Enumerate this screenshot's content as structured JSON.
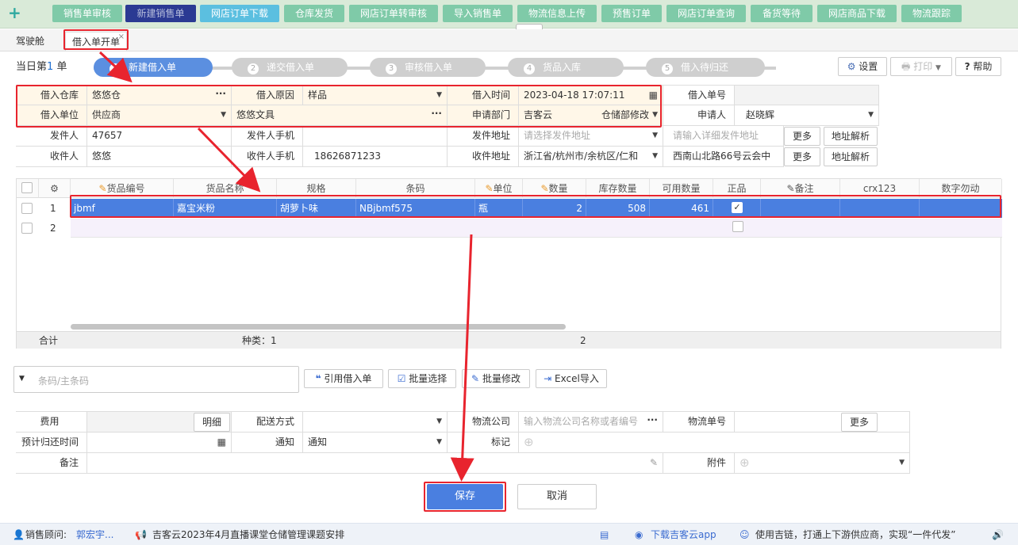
{
  "nav": {
    "plus": "+",
    "tabs": [
      "销售单审核",
      "新建销售单",
      "网店订单下载",
      "仓库发货",
      "网店订单转审核",
      "导入销售单",
      "物流信息上传",
      "预售订单",
      "网店订单查询",
      "备货等待",
      "网店商品下载",
      "物流跟踪"
    ]
  },
  "subtabs": {
    "cockpit": "驾驶舱",
    "current": "借入单开单",
    "close": "×"
  },
  "steps": {
    "day_prefix": "当日第",
    "day_num": "1",
    "day_suffix": "单",
    "items": [
      {
        "n": "1",
        "label": "新建借入单"
      },
      {
        "n": "2",
        "label": "递交借入单"
      },
      {
        "n": "3",
        "label": "审核借入单"
      },
      {
        "n": "4",
        "label": "货品入库"
      },
      {
        "n": "5",
        "label": "借入待归还"
      }
    ]
  },
  "toolbar": {
    "settings": "设置",
    "print": "打印",
    "help": "帮助"
  },
  "form": {
    "warehouse_label": "借入仓库",
    "warehouse": "悠悠仓",
    "reason_label": "借入原因",
    "reason": "样品",
    "time_label": "借入时间",
    "time": "2023-04-18 17:07:11",
    "order_no_label": "借入单号",
    "order_no": "",
    "unit_label": "借入单位",
    "unit_type": "供应商",
    "unit": "悠悠文具",
    "dept_label": "申请部门",
    "dept": "吉客云",
    "dept2": "仓储部修改",
    "applicant_label": "申请人",
    "applicant": "赵晓辉",
    "sender_label": "发件人",
    "sender": "47657",
    "sender_phone_label": "发件人手机",
    "sender_phone": "",
    "sender_addr_label": "发件地址",
    "sender_addr_ph": "请选择发件地址",
    "sender_detail_ph": "请输入详细发件地址",
    "more": "更多",
    "parse": "地址解析",
    "receiver_label": "收件人",
    "receiver": "悠悠",
    "receiver_phone_label": "收件人手机",
    "receiver_phone": "18626871233",
    "receiver_addr_label": "收件地址",
    "receiver_addr": "浙江省/杭州市/余杭区/仁和",
    "receiver_detail": "西南山北路66号云会中"
  },
  "table": {
    "headers": [
      "货品编号",
      "货品名称",
      "规格",
      "条码",
      "单位",
      "数量",
      "库存数量",
      "可用数量",
      "正品",
      "备注",
      "crx123",
      "数字勿动"
    ],
    "rows": [
      {
        "no": "1",
        "code": "jbmf",
        "name": "嘉宝米粉",
        "spec": "胡萝卜味",
        "barcode": "NBjbmf575",
        "unit": "瓶",
        "qty": "2",
        "stock": "508",
        "avail": "461"
      },
      {
        "no": "2"
      }
    ],
    "total_label": "合计",
    "kinds": "种类：1",
    "total_qty": "2"
  },
  "scan": {
    "placeholder": "条码/主条码"
  },
  "actions": {
    "quote": "引用借入单",
    "batch_select": "批量选择",
    "batch_edit": "批量修改",
    "excel": "Excel导入"
  },
  "bottom": {
    "fee_label": "费用",
    "detail": "明细",
    "ship_label": "配送方式",
    "logistics_label": "物流公司",
    "logistics_ph": "输入物流公司名称或者编号",
    "logistics_no_label": "物流单号",
    "more": "更多",
    "return_label": "预计归还时间",
    "notify_label": "通知",
    "notify": "通知",
    "mark_label": "标记",
    "remark_label": "备注",
    "attach_label": "附件"
  },
  "buttons": {
    "save": "保存",
    "cancel": "取消"
  },
  "footer": {
    "advisor_label": "销售顾问:",
    "advisor": "郭宏宇...",
    "notice": "吉客云2023年4月直播课堂仓储管理课题安排",
    "download": "下载吉客云app",
    "slogan": "使用吉链，打通上下游供应商，实现“一件代发”"
  },
  "colors": {
    "nav_green": "#7fcaa8",
    "nav_active": "#2b3a93",
    "accent_blue": "#4a7fe0",
    "annotation_red": "#e8242e"
  }
}
